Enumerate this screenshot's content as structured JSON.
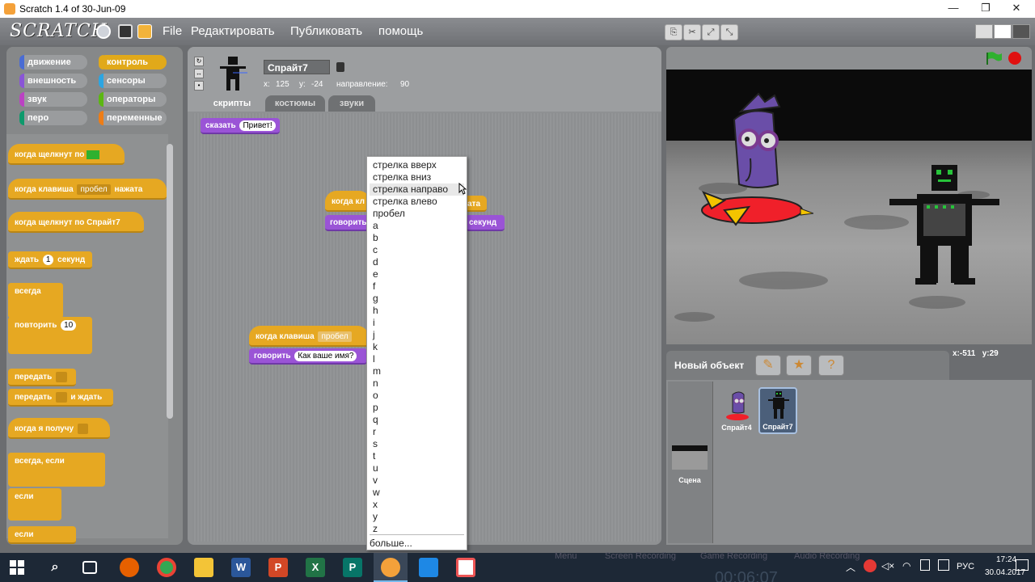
{
  "window": {
    "title": "Scratch 1.4 of 30-Jun-09",
    "controls": [
      "—",
      "❐",
      "✕"
    ]
  },
  "menubar": {
    "logo": "SCRATCH",
    "items": [
      "File",
      "Редактировать",
      "Публиковать",
      "помощь"
    ]
  },
  "categories": {
    "left": [
      "движение",
      "внешность",
      "звук",
      "перо"
    ],
    "right": [
      "контроль",
      "сенсоры",
      "операторы",
      "переменные"
    ],
    "colors": {
      "движение": "#4a6cd4",
      "внешность": "#8a55d7",
      "звук": "#bb42c3",
      "перо": "#0e9a6c",
      "контроль": "#e1a91a",
      "сенсоры": "#2ca5e2",
      "операторы": "#5cb712",
      "переменные": "#ee7d16"
    }
  },
  "palette": {
    "when_flag": "когда щелкнут по",
    "when_key": "когда клавиша",
    "when_key_value": "пробел",
    "when_key_suffix": "нажата",
    "when_sprite_clicked": "когда щелкнут по  Спрайт7",
    "wait": "ждать",
    "wait_value": "1",
    "wait_suffix": "секунд",
    "forever": "всегда",
    "repeat": "повторить",
    "repeat_value": "10",
    "broadcast": "передать",
    "broadcast_wait": "передать",
    "broadcast_wait_suffix": "и ждать",
    "when_receive": "когда я получу",
    "forever_if": "всегда, если",
    "if1": "если",
    "if2": "если"
  },
  "sprite": {
    "name": "Спрайт7",
    "x_label": "x:",
    "x": "125",
    "y_label": "y:",
    "y": "-24",
    "direction_label": "направление:",
    "direction": "90"
  },
  "tabs": [
    "скрипты",
    "костюмы",
    "звуки"
  ],
  "scripts": {
    "say_block": "сказать",
    "say_value": "Привет!",
    "script2_hat_left": "когда кл",
    "script2_hat_right": "ата",
    "script2_say_left": "говорить",
    "script2_say_right": "секунд",
    "script3_hat": "когда клавиша",
    "script3_hat_value": "пробел",
    "script3_say": "говорить",
    "script3_say_value": "Как ваше имя?"
  },
  "dropdown": {
    "options": [
      "стрелка вверх",
      "стрелка вниз",
      "стрелка направо",
      "стрелка влево",
      "пробел",
      "a",
      "b",
      "c",
      "d",
      "e",
      "f",
      "g",
      "h",
      "i",
      "j",
      "k",
      "l",
      "m",
      "n",
      "o",
      "p",
      "q",
      "r",
      "s",
      "t",
      "u",
      "v",
      "w",
      "x",
      "y",
      "z"
    ],
    "highlighted_index": 2,
    "more": "больше..."
  },
  "stage": {
    "coords_x_label": "x:",
    "coords_x": "-511",
    "coords_y_label": "y:",
    "coords_y": "29"
  },
  "sprites_panel": {
    "new_object": "Новый объект",
    "sprites": [
      "Спрайт4",
      "Спрайт7"
    ],
    "selected": "Спрайт7",
    "stage_label": "Сцена"
  },
  "taskbar": {
    "background_apps": [
      "Menu",
      "Screen Recording",
      "Game Recording",
      "Audio Recording"
    ],
    "recorder_time": "00:06:07",
    "language": "РУС",
    "time": "17:24",
    "date": "30.04.2017"
  },
  "colors": {
    "control": "#e6a822",
    "looks": "#9a54d6",
    "green_flag": "#2fb12f",
    "stop": "#e01010"
  }
}
